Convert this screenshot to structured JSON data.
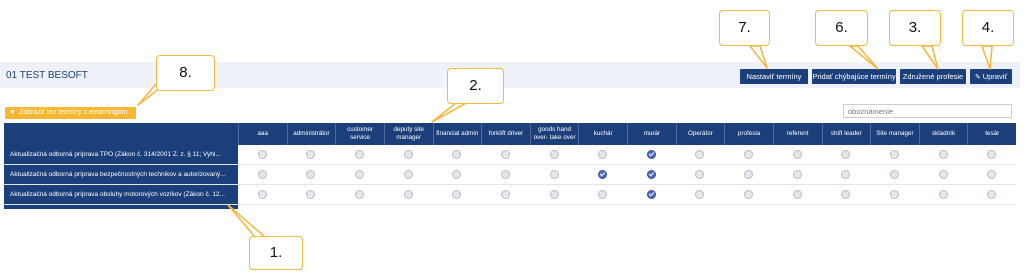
{
  "page": {
    "title": "01 TEST BESOFT"
  },
  "toolbar": {
    "set_terms": "Nastaviť termíny",
    "add_missing": "Pridať chýbajúce termíny",
    "combined": "Združené profesie",
    "edit": "Upraviť",
    "edit_icon": "edit-icon"
  },
  "filter": {
    "label": "Zobraziť len termíny s elearningom",
    "icon": "filter-icon"
  },
  "search": {
    "placeholder": "oboznámenie"
  },
  "matrix": {
    "columns": [
      "aaa",
      "administrátor",
      "customer service",
      "deputy site manager",
      "financial admin",
      "forklift driver",
      "goods hand over- take over",
      "kuchár",
      "murár",
      "Operátor",
      "profesia",
      "referent",
      "shift leader",
      "Site manager",
      "skladník",
      "tesár"
    ],
    "rows": [
      {
        "name": "Aktualizačná odborná príprava TPO (Zákon č. 314/2001 Z. z. § 11; Vyhl...",
        "checked": [
          8
        ]
      },
      {
        "name": "Aktualizačná odborná príprava bezpečnostných technikov a autorizovaný...",
        "checked": [
          7,
          8
        ]
      },
      {
        "name": "Aktualizačná odborná príprava obsluhy motorových vozíkov (Zákon č. 12...",
        "checked": [
          8
        ]
      }
    ]
  },
  "annotations": {
    "c1": "1.",
    "c2": "2.",
    "c3": "3.",
    "c4": "4.",
    "c6": "6.",
    "c7": "7.",
    "c8": "8.",
    "color": "#f4b942"
  }
}
